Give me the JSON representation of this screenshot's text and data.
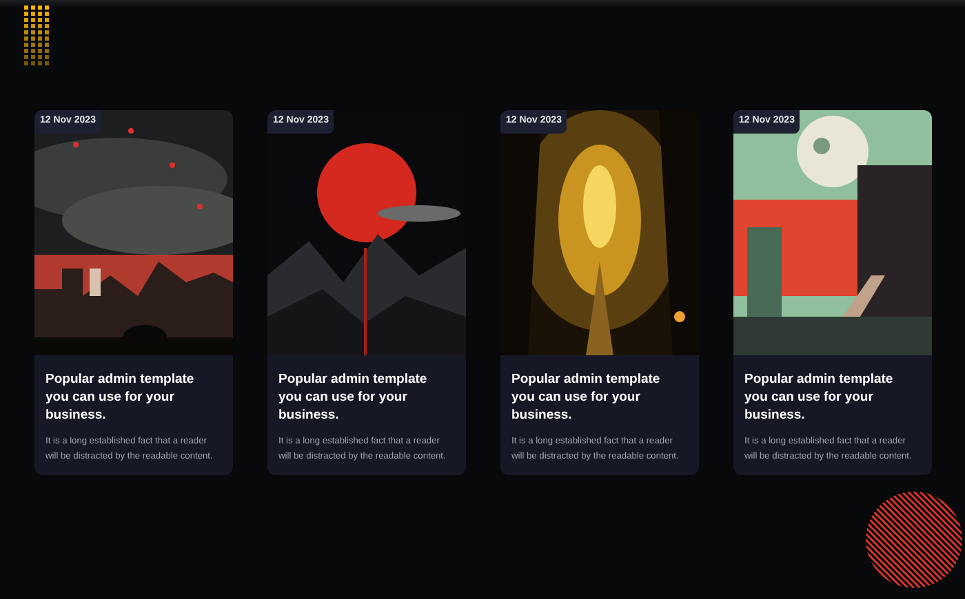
{
  "cards": [
    {
      "date": "12 Nov 2023",
      "title": "Popular admin template you can use for your business.",
      "text": "It is a long established fact that a reader will be distracted by the readable content."
    },
    {
      "date": "12 Nov 2023",
      "title": "Popular admin template you can use for your business.",
      "text": "It is a long established fact that a reader will be distracted by the readable content."
    },
    {
      "date": "12 Nov 2023",
      "title": "Popular admin template you can use for your business.",
      "text": "It is a long established fact that a reader will be distracted by the readable content."
    },
    {
      "date": "12 Nov 2023",
      "title": "Popular admin template you can use for your business.",
      "text": "It is a long established fact that a reader will be distracted by the readable content."
    }
  ]
}
